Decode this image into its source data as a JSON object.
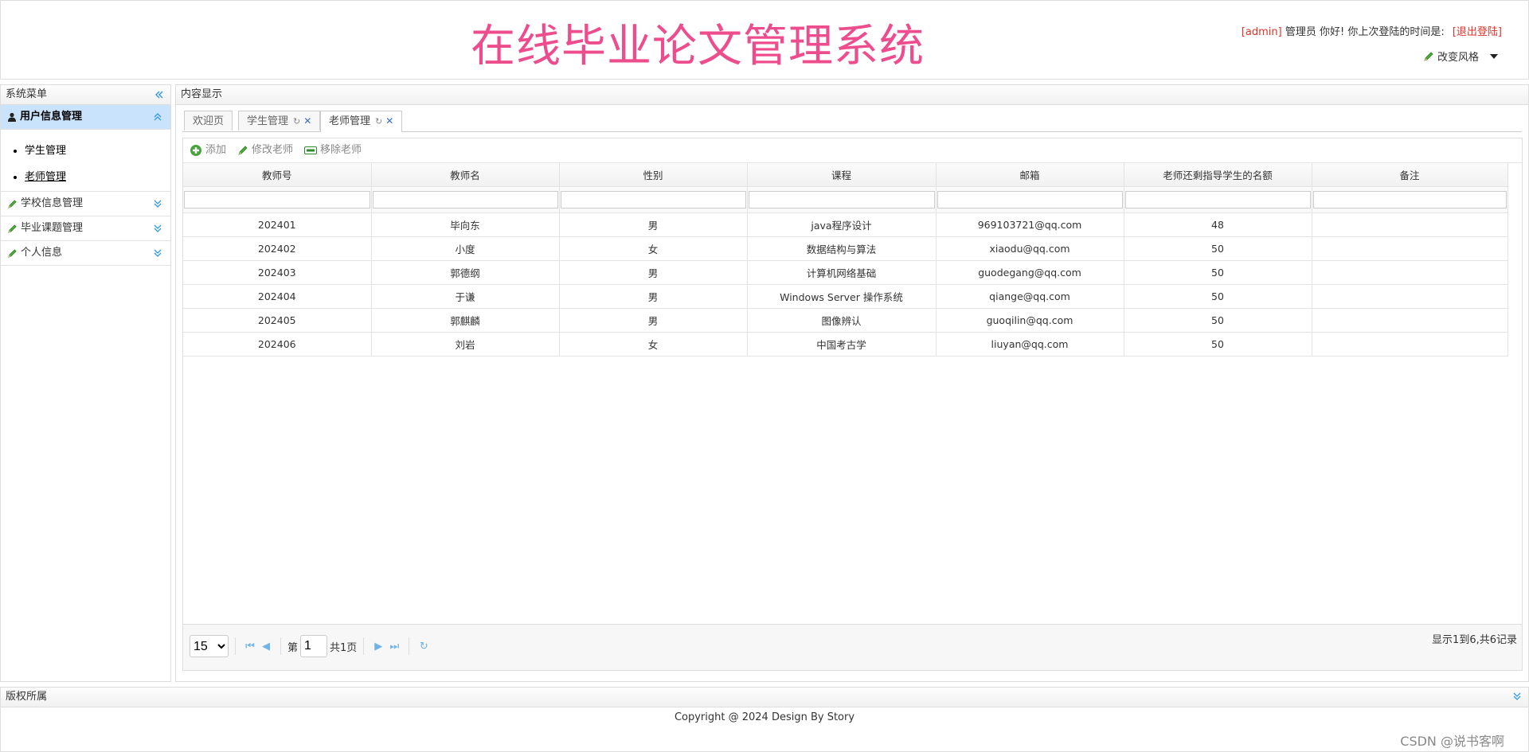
{
  "header": {
    "title": "在线毕业论文管理系统",
    "user": "[admin]",
    "role": "管理员",
    "greeting": "你好! 你上次登陆的时间是:",
    "logout": "[退出登陆]",
    "style_switch": "改变风格"
  },
  "sidebar": {
    "title": "系统菜单",
    "groups": [
      {
        "label": "用户信息管理",
        "items": [
          "学生管理",
          "老师管理"
        ]
      },
      {
        "label": "学校信息管理"
      },
      {
        "label": "毕业课题管理"
      },
      {
        "label": "个人信息"
      }
    ]
  },
  "content": {
    "title": "内容显示",
    "tabs": [
      {
        "label": "欢迎页"
      },
      {
        "label": "学生管理"
      },
      {
        "label": "老师管理"
      }
    ],
    "toolbar": {
      "add": "添加",
      "edit": "修改老师",
      "remove": "移除老师"
    },
    "columns": [
      "教师号",
      "教师名",
      "性别",
      "课程",
      "邮箱",
      "老师还剩指导学生的名额",
      "备注"
    ],
    "rows": [
      [
        "202401",
        "毕向东",
        "男",
        "java程序设计",
        "969103721@qq.com",
        "48",
        ""
      ],
      [
        "202402",
        "小度",
        "女",
        "数据结构与算法",
        "xiaodu@qq.com",
        "50",
        ""
      ],
      [
        "202403",
        "郭德纲",
        "男",
        "计算机网络基础",
        "guodegang@qq.com",
        "50",
        ""
      ],
      [
        "202404",
        "于谦",
        "男",
        "Windows Server 操作系统",
        "qiange@qq.com",
        "50",
        ""
      ],
      [
        "202405",
        "郭麒麟",
        "男",
        "图像辨认",
        "guoqilin@qq.com",
        "50",
        ""
      ],
      [
        "202406",
        "刘岩",
        "女",
        "中国考古学",
        "liuyan@qq.com",
        "50",
        ""
      ]
    ],
    "pager": {
      "page_size": "15",
      "page_prefix": "第",
      "current_page": "1",
      "total_pages": "共1页",
      "summary": "显示1到6,共6记录"
    }
  },
  "footer": {
    "title": "版权所属",
    "copyright": "Copyright @ 2024 Design By Story",
    "watermark": "CSDN @说书客啊"
  },
  "colors": {
    "title": "#ee4d8d",
    "accent": "#3399dd",
    "active_menu": "#c8e3fb",
    "quota": "#1a8a1a",
    "logout": "#e0332a"
  }
}
